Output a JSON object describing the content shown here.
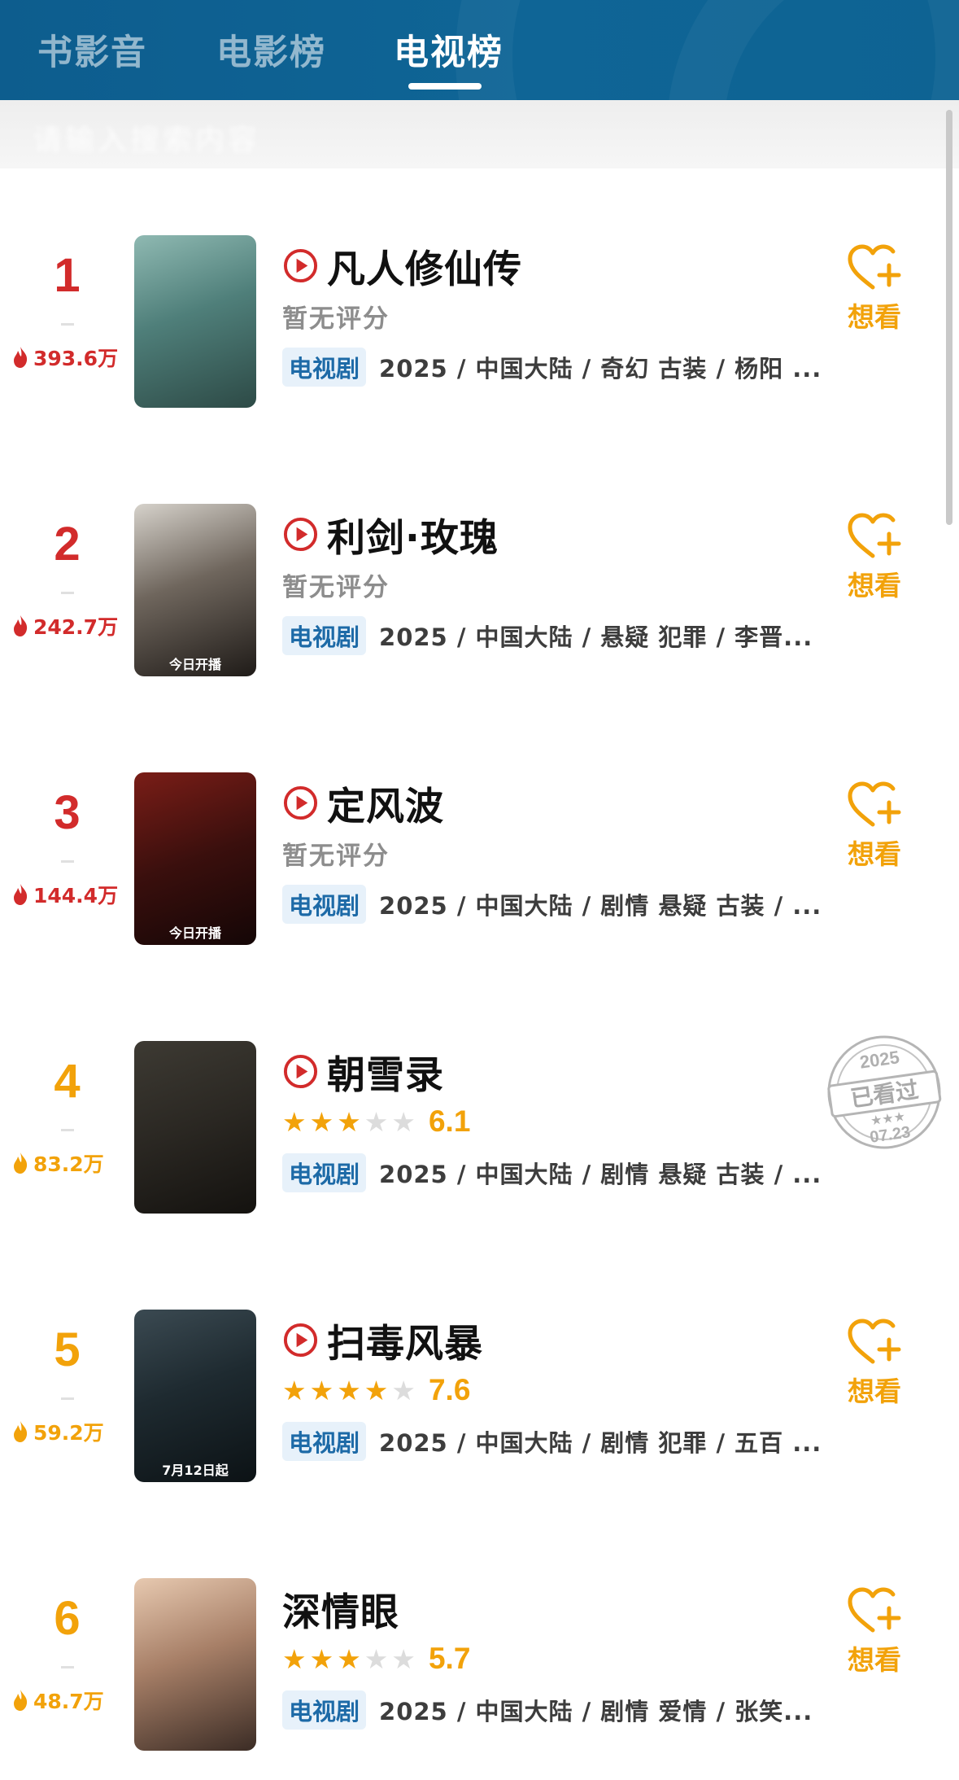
{
  "tabs": [
    {
      "label": "书影音"
    },
    {
      "label": "电影榜"
    },
    {
      "label": "电视榜"
    }
  ],
  "subbar_text": "请输入搜索内容",
  "want_label": "想看",
  "no_score_label": "暂无评分",
  "watched_stamp": {
    "year": "2025",
    "label": "已看过",
    "stars": "★★★",
    "date": "07.23"
  },
  "colors": {
    "header_bg": "#0e6393",
    "rank_top": "#d22b2b",
    "rank_other": "#f2a20a",
    "accent_orange": "#f2a20a",
    "badge_blue": "#1d6aa7"
  },
  "items": [
    {
      "rank": "1",
      "heat": "393.6万",
      "title": "凡人修仙传",
      "has_play": true,
      "rating": null,
      "score": "",
      "type": "电视剧",
      "meta": "2025 / 中国大陆 / 奇幻 古装 / 杨阳 ...",
      "poster_caption": "",
      "status": "want"
    },
    {
      "rank": "2",
      "heat": "242.7万",
      "title": "利剑·玫瑰",
      "has_play": true,
      "rating": null,
      "score": "",
      "type": "电视剧",
      "meta": "2025 / 中国大陆 / 悬疑 犯罪 / 李晋...",
      "poster_caption": "今日开播",
      "status": "want"
    },
    {
      "rank": "3",
      "heat": "144.4万",
      "title": "定风波",
      "has_play": true,
      "rating": null,
      "score": "",
      "type": "电视剧",
      "meta": "2025 / 中国大陆 / 剧情 悬疑 古装 / ...",
      "poster_caption": "今日开播",
      "status": "want"
    },
    {
      "rank": "4",
      "heat": "83.2万",
      "title": "朝雪录",
      "has_play": true,
      "rating": 3,
      "score": "6.1",
      "type": "电视剧",
      "meta": "2025 / 中国大陆 / 剧情 悬疑 古装 / ...",
      "poster_caption": "",
      "status": "watched"
    },
    {
      "rank": "5",
      "heat": "59.2万",
      "title": "扫毒风暴",
      "has_play": true,
      "rating": 4,
      "score": "7.6",
      "type": "电视剧",
      "meta": "2025 / 中国大陆 / 剧情 犯罪 / 五百 ...",
      "poster_caption": "7月12日起",
      "status": "want"
    },
    {
      "rank": "6",
      "heat": "48.7万",
      "title": "深情眼",
      "has_play": false,
      "rating": 3,
      "score": "5.7",
      "type": "电视剧",
      "meta": "2025 / 中国大陆 / 剧情 爱情 / 张笑...",
      "poster_caption": "",
      "status": "want"
    }
  ]
}
